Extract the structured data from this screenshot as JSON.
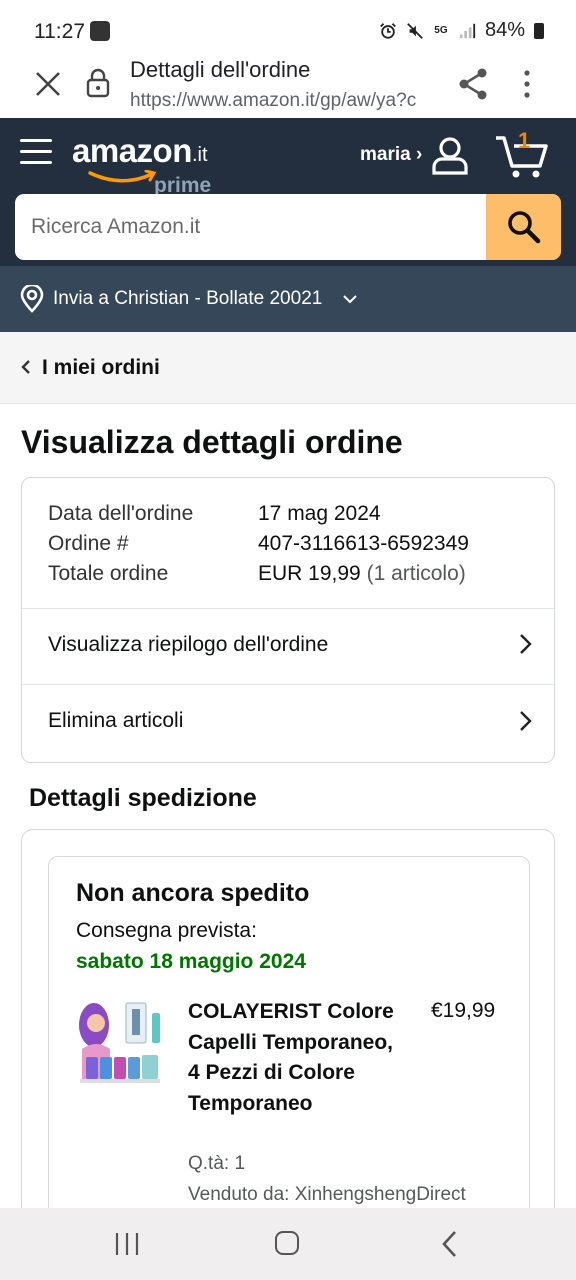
{
  "status_bar": {
    "time": "11:27",
    "network": "5G",
    "battery": "84%"
  },
  "browser": {
    "page_title": "Dettagli dell'ordine",
    "url": "https://www.amazon.it/gp/aw/ya?c"
  },
  "header": {
    "logo_word": "amazon",
    "logo_tld": ".it",
    "logo_prime": "prime",
    "user_label": "maria ›",
    "cart_count": "1",
    "brand_color": "#232f3e",
    "accent_color": "#febd69"
  },
  "search": {
    "placeholder": "Ricerca Amazon.it"
  },
  "deliver": {
    "text": "Invia a Christian - Bollate 20021"
  },
  "breadcrumb": {
    "label": "I miei ordini"
  },
  "page": {
    "title": "Visualizza dettagli ordine"
  },
  "order": {
    "date_label": "Data dell'ordine",
    "date_value": "17 mag 2024",
    "number_label": "Ordine #",
    "number_value": "407-3116613-6592349",
    "total_label": "Totale ordine",
    "total_value": "EUR 19,99",
    "total_count": "(1 articolo)",
    "link_summary": "Visualizza riepilogo dell'ordine",
    "link_delete": "Elimina articoli"
  },
  "shipping": {
    "heading": "Dettagli spedizione",
    "status": "Non ancora spedito",
    "expected_label": "Consegna prevista:",
    "expected_date": "sabato 18 maggio 2024",
    "item": {
      "name": "COLAYERIST Colore Capelli Temporaneo, 4 Pezzi di Colore Temporaneo",
      "price": "€19,99",
      "qty": "Q.tà: 1",
      "seller": "Venduto da: XinhengshengDirect"
    }
  }
}
